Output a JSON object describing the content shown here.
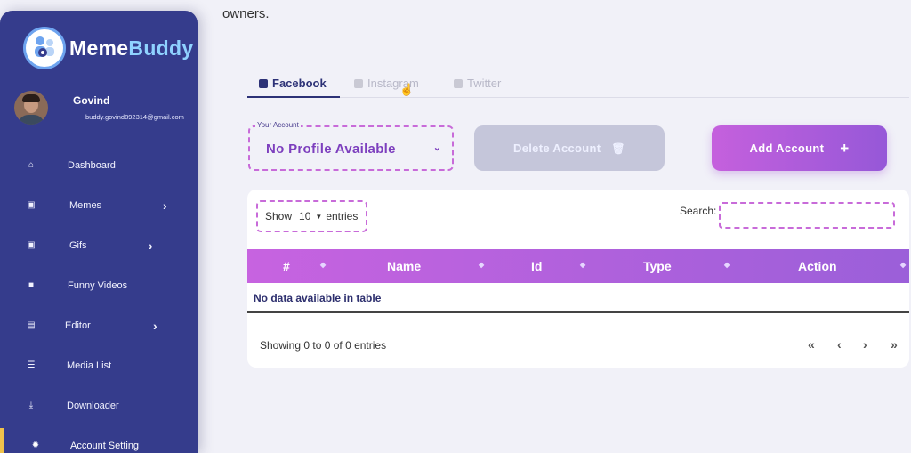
{
  "brand": {
    "part1": "Meme",
    "part2": "Buddy"
  },
  "user": {
    "name": "Govind",
    "email": "buddy.govind892314@gmail.com"
  },
  "nav": [
    {
      "label": "Dashboard",
      "icon": "home-icon",
      "chevron": ""
    },
    {
      "label": "Memes",
      "icon": "images-icon",
      "chevron": "›"
    },
    {
      "label": "Gifs",
      "icon": "images-icon",
      "chevron": "›"
    },
    {
      "label": "Funny Videos",
      "icon": "video-icon",
      "chevron": ""
    },
    {
      "label": "Editor",
      "icon": "file-icon",
      "chevron": "›"
    },
    {
      "label": "Media List",
      "icon": "list-icon",
      "chevron": ""
    },
    {
      "label": "Downloader",
      "icon": "download-icon",
      "chevron": ""
    },
    {
      "label": "Account Setting",
      "icon": "gear-icon",
      "chevron": ""
    }
  ],
  "intro_text": "owners.",
  "tabs": {
    "facebook": "Facebook",
    "instagram": "Instagram",
    "twitter": "Twitter"
  },
  "account": {
    "legend": "Your Account",
    "selected": "No Profile Available"
  },
  "buttons": {
    "delete": "Delete Account",
    "add": "Add Account"
  },
  "table": {
    "show_label": "Show",
    "entries_value": "10",
    "entries_label": "entries",
    "search_label": "Search:",
    "columns": [
      "#",
      "Name",
      "Id",
      "Type",
      "Action"
    ],
    "empty_text": "No data available in table",
    "info": "Showing 0 to 0 of 0 entries",
    "pager": [
      "«",
      "‹",
      "›",
      "»"
    ]
  },
  "colors": {
    "sidebar": "#353c8c",
    "accent": "#c560dd",
    "accent2": "#9658d8",
    "active_marker": "#f0c24b"
  }
}
